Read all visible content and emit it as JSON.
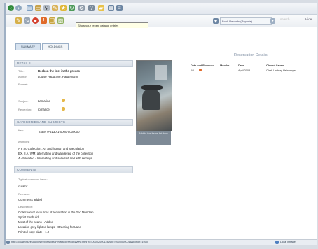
{
  "toolbar": {
    "tooltip": "Show your recent catalog entries",
    "zoom": "Book Records (Reports) ",
    "right_link": "Hide",
    "search_placeholder": "search"
  },
  "tabs": [
    "SUMMARY",
    "HOLDINGS"
  ],
  "details": {
    "header": "DETAILS",
    "title_label": "Title:",
    "title_value": "Beckon the lost in the groves",
    "author_label": "Author:",
    "author_value": "Louise Hapgrave, Hargemann",
    "format_label": "Format:",
    "subject_label": "Subject:",
    "subject_value": "Lamarine",
    "reception_label": "Reception:",
    "reception_value": "romance"
  },
  "classification": {
    "header": "CATEGORIES AND SUBJECTS",
    "key_label": "Key:",
    "key_value": "ISBN 0-5130-1-0000-5000000",
    "archives_label": "Archives:",
    "lines": [
      "A 8 Sc Collection: Art and human and speculation",
      "BX, 8 A, WM: alternating and wandering of the collection",
      "4 - 9 related - Interesting and selected and with settings"
    ]
  },
  "comments": {
    "header": "COMMENTS",
    "label1": "Typical comment items:",
    "value1": "curator",
    "label2": "Remarks:",
    "value2": "Comments added",
    "label3": "Description:",
    "desc": [
      "Collection of resources of renovation in the 2nd Meridian",
      "Sprint 2 rebuild:",
      "Most of the scans - Added",
      "Location grey lighted lamps - Ordering for Lane",
      "Printed copy plate - 1.0"
    ]
  },
  "thumbnail": {
    "button_text": "Add to the items list item"
  },
  "right_panel": {
    "title": "Reservation Details",
    "columns": [
      "Date and Received",
      "Months",
      "Date",
      "Closed Cause"
    ],
    "row": [
      "0/1",
      "April 2008",
      "Clark Lindsay Heinberger",
      ""
    ]
  },
  "status": {
    "url": "http://localhost/resources/reports/library/catalog/record/view.html?id=0000200012&type=0000000001&section=1000",
    "zone": "Local intranet"
  }
}
